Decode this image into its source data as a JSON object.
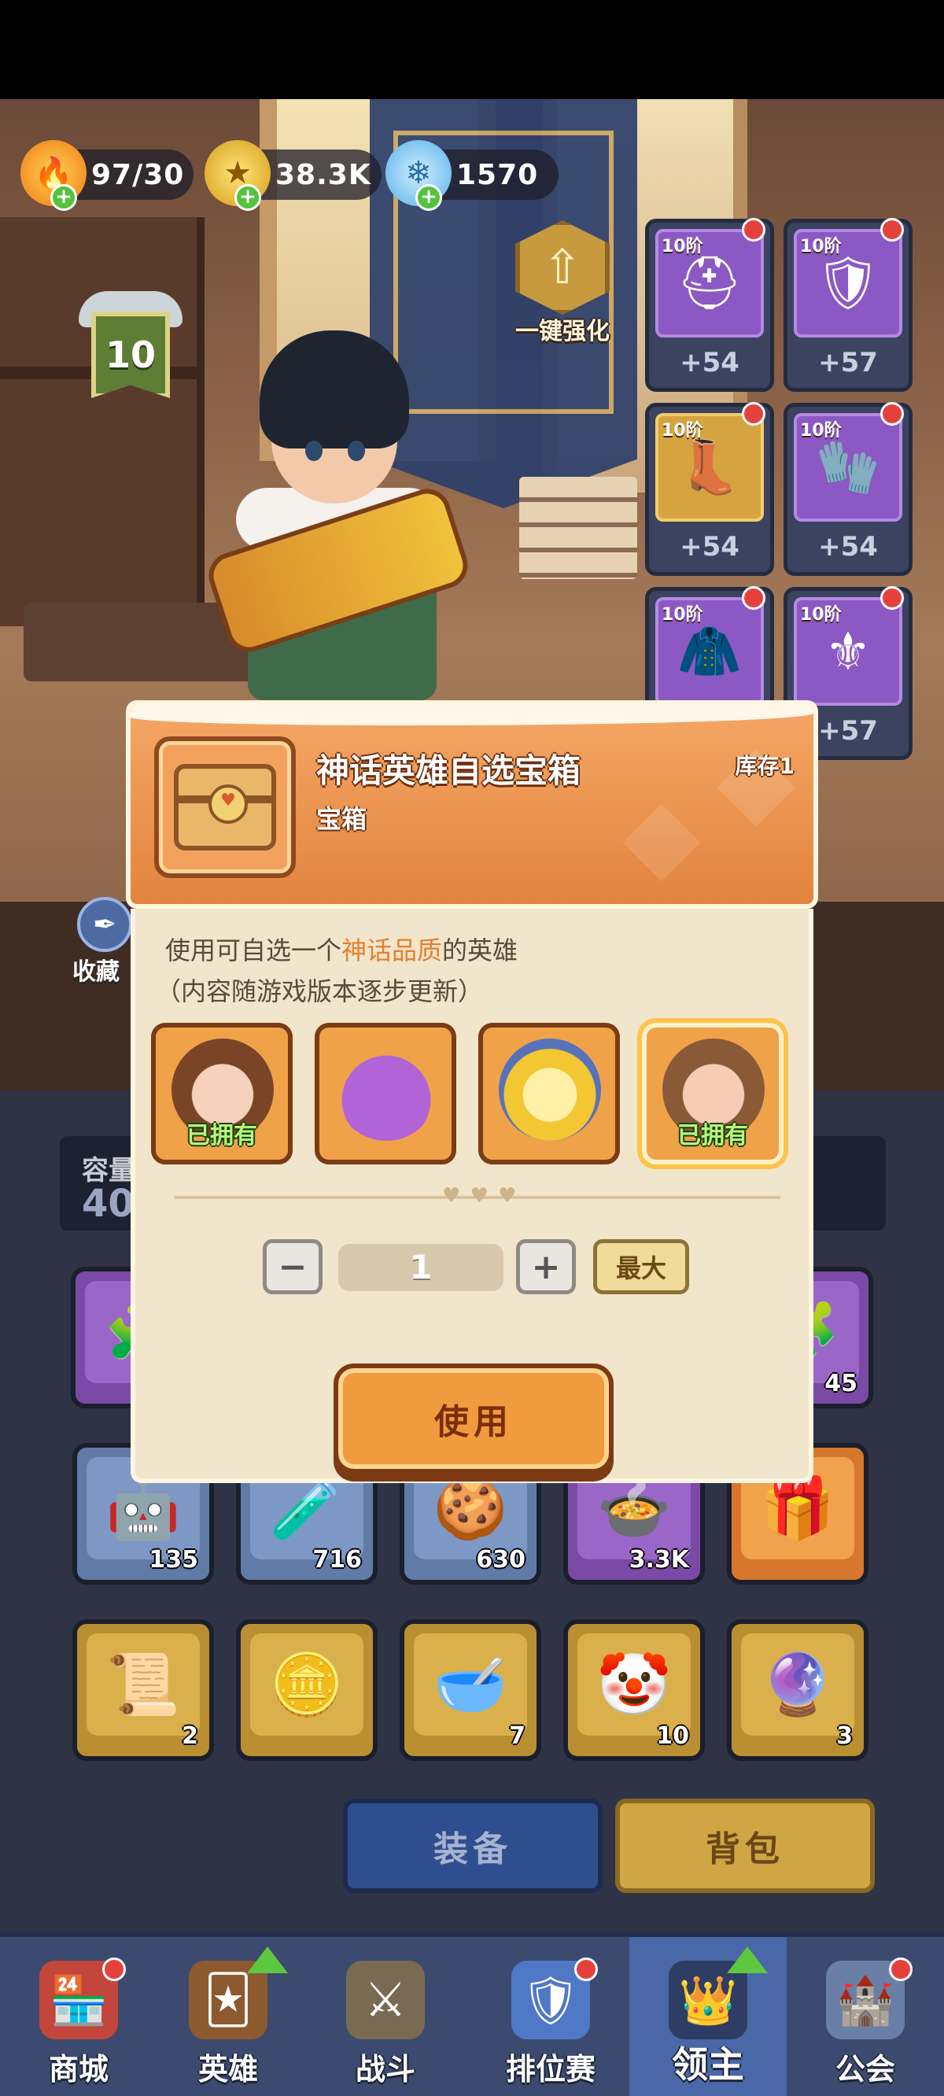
{
  "currency": {
    "energy": "97/30",
    "gold": "38.3K",
    "gems": "1570"
  },
  "level_badge": "10",
  "one_key_upgrade": "一键强化",
  "equipment": [
    {
      "tier": "10阶",
      "bonus": "+54",
      "icon": "helmet-icon"
    },
    {
      "tier": "10阶",
      "bonus": "+57",
      "icon": "armor-icon"
    },
    {
      "tier": "10阶",
      "bonus": "+54",
      "icon": "boots-icon"
    },
    {
      "tier": "10阶",
      "bonus": "+54",
      "icon": "gauntlet-icon"
    },
    {
      "tier": "10阶",
      "bonus": "",
      "icon": "cape-icon"
    },
    {
      "tier": "10阶",
      "bonus": "+57",
      "icon": "skirt-icon"
    }
  ],
  "collect_label": "收藏",
  "capacity": {
    "label": "容量",
    "value": "40"
  },
  "inventory": {
    "row1": [
      {
        "count": ""
      },
      {
        "count": "45"
      }
    ],
    "row2": [
      {
        "count": "135"
      },
      {
        "count": "716"
      },
      {
        "count": "630"
      },
      {
        "count": "3.3K"
      },
      {
        "count": ""
      }
    ],
    "row3": [
      {
        "count": "2"
      },
      {
        "count": ""
      },
      {
        "count": "7"
      },
      {
        "count": "10"
      },
      {
        "count": "3"
      }
    ]
  },
  "tabs": {
    "equip": "装备",
    "bag": "背包"
  },
  "nav": [
    {
      "label": "商城",
      "icon": "shop-icon"
    },
    {
      "label": "英雄",
      "icon": "hero-card-icon"
    },
    {
      "label": "战斗",
      "icon": "battle-icon"
    },
    {
      "label": "排位赛",
      "icon": "ranked-icon"
    },
    {
      "label": "领主",
      "icon": "lord-icon"
    },
    {
      "label": "公会",
      "icon": "guild-icon"
    }
  ],
  "modal": {
    "title": "神话英雄自选宝箱",
    "type": "宝箱",
    "stock": "库存1",
    "desc_prefix": "使用可自选一个",
    "desc_highlight": "神话品质",
    "desc_suffix": "的英雄",
    "desc_note": "（内容随游戏版本逐步更新）",
    "heroes": [
      {
        "owned": "已拥有"
      },
      {
        "owned": ""
      },
      {
        "owned": ""
      },
      {
        "owned": "已拥有"
      }
    ],
    "quantity": "1",
    "max_label": "最大",
    "use_label": "使用"
  },
  "colors": {
    "highlight": "#e3812f",
    "owned_text": "#b6f47a",
    "panel_bg": "#f1e5cb"
  }
}
